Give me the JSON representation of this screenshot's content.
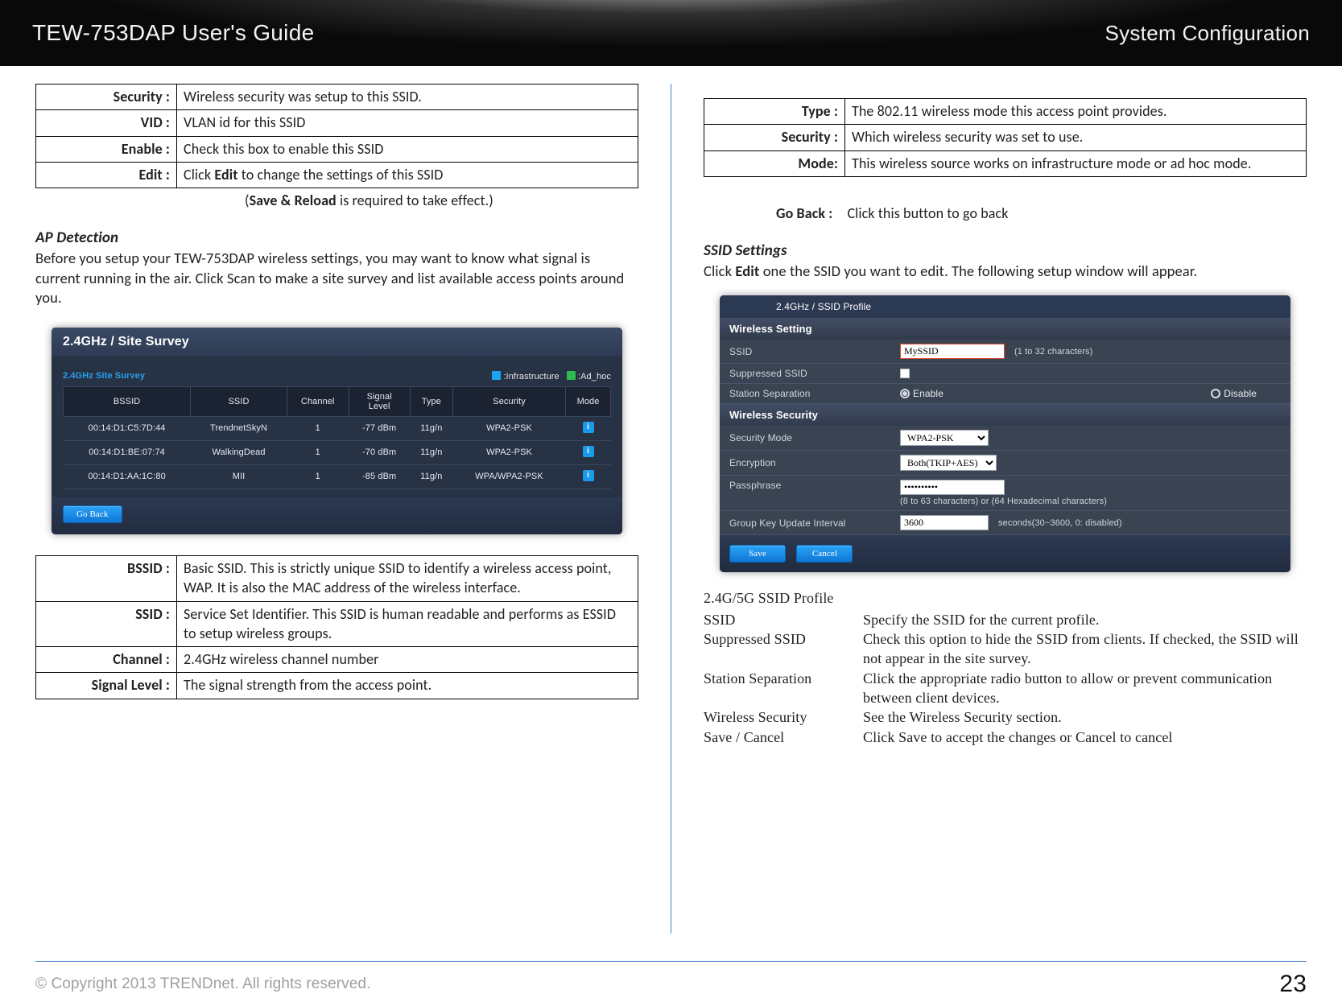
{
  "header": {
    "left": "TEW-753DAP User's Guide",
    "right": "System Configuration"
  },
  "left": {
    "tableA": [
      {
        "k": "Security :",
        "v": "Wireless security was setup to this SSID."
      },
      {
        "k": "VID :",
        "v": "VLAN id for this SSID"
      },
      {
        "k": "Enable :",
        "v": "Check this box to enable this SSID"
      },
      {
        "k": "Edit :",
        "v": "Click <b>Edit</b> to change the settings of this SSID"
      }
    ],
    "save_reload": "(<b>Save & Reload</b> is required to take effect.)",
    "ap_heading": "AP Detection",
    "ap_para": "Before you setup your TEW-753DAP wireless settings, you may want to know what signal is current running in the air. Click Scan to make a site survey and list available access points around you.",
    "survey": {
      "title": "2.4GHz / Site Survey",
      "subtitle": "2.4GHz Site Survey",
      "legend_infra": ":Infrastructure",
      "legend_adhoc": ":Ad_hoc",
      "cols": [
        "BSSID",
        "SSID",
        "Channel",
        "Signal\nLevel",
        "Type",
        "Security",
        "Mode"
      ],
      "rows": [
        [
          "00:14:D1:C5:7D:44",
          "TrendnetSkyN",
          "1",
          "-77 dBm",
          "11g/n",
          "WPA2-PSK",
          "i"
        ],
        [
          "00:14:D1:BE:07:74",
          "WalkingDead",
          "1",
          "-70 dBm",
          "11g/n",
          "WPA2-PSK",
          "i"
        ],
        [
          "00:14:D1:AA:1C:80",
          "MII",
          "1",
          "-85 dBm",
          "11g/n",
          "WPA/WPA2-PSK",
          "i"
        ]
      ],
      "go_back_btn": "Go Back"
    },
    "tableB": [
      {
        "k": "BSSID :",
        "v": "Basic SSID. This is strictly unique SSID to identify a wireless access point, WAP. It is also the MAC address of the wireless interface."
      },
      {
        "k": "SSID :",
        "v": "Service Set Identifier. This SSID is human readable and performs as ESSID to setup wireless groups."
      },
      {
        "k": "Channel :",
        "v": "2.4GHz wireless channel number"
      },
      {
        "k": "Signal Level :",
        "v": "The signal strength from the access point."
      }
    ]
  },
  "right": {
    "tableC": [
      {
        "k": "Type :",
        "v": "The 802.11 wireless mode this access point provides."
      },
      {
        "k": "Security :",
        "v": "Which wireless security was set to use."
      },
      {
        "k": "Mode:",
        "v": "This wireless source works on infrastructure mode or ad hoc mode."
      }
    ],
    "goback": {
      "label": "Go Back :",
      "text": "Click this button to go back"
    },
    "ssid_heading": "SSID Settings",
    "ssid_para": "Click <b>Edit</b> one the SSID you want to edit. The following setup window will appear.",
    "profile": {
      "topbar": "2.4GHz / SSID Profile",
      "sec1": "Wireless Setting",
      "rows1": {
        "ssid_lbl": "SSID",
        "ssid_val": "MySSID",
        "ssid_help": "(1 to 32 characters)",
        "sup_lbl": "Suppressed SSID",
        "sta_lbl": "Station Separation",
        "sta_en": "Enable",
        "sta_dis": "Disable"
      },
      "sec2": "Wireless Security",
      "rows2": {
        "mode_lbl": "Security Mode",
        "mode_val": "WPA2-PSK",
        "enc_lbl": "Encryption",
        "enc_val": "Both(TKIP+AES)",
        "pass_lbl": "Passphrase",
        "pass_val": "••••••••••",
        "pass_help": "(8 to 63 characters) or (64 Hexadecimal characters)",
        "gk_lbl": "Group Key Update Interval",
        "gk_val": "3600",
        "gk_help": "seconds(30~3600, 0: disabled)"
      },
      "save": "Save",
      "cancel": "Cancel"
    },
    "serif": {
      "title": "2.4G/5G SSID Profile",
      "lines": [
        {
          "k": "SSID",
          "v": "Specify the SSID for the current profile."
        },
        {
          "k": "Suppressed SSID",
          "v": "Check this option to hide the SSID from clients. If checked, the SSID will not appear in the site survey."
        },
        {
          "k": "Station Separation",
          "v": "Click the appropriate radio button to allow or prevent communication between client devices."
        },
        {
          "k": "Wireless Security",
          "v": "See the Wireless Security section."
        },
        {
          "k": "Save / Cancel",
          "v": "Click Save to accept the changes or Cancel to cancel"
        }
      ]
    }
  },
  "footer": {
    "copyright": "© Copyright 2013 TRENDnet. All rights reserved.",
    "page": "23"
  }
}
